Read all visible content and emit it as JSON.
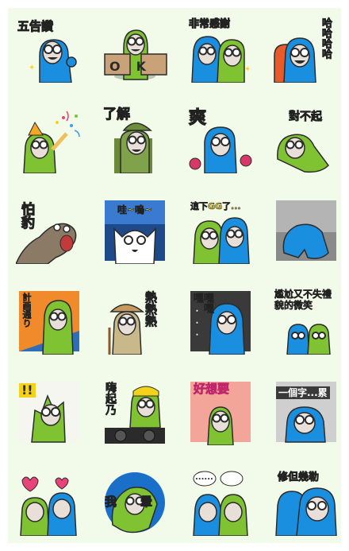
{
  "colors": {
    "sheet_bg": "#f2fbe9",
    "blue_char": "#1a8fe0",
    "green_char": "#7fc232",
    "skin": "#e8e0d8",
    "outline": "#2b2b2b"
  },
  "stickers": [
    {
      "id": 1,
      "caption": "五告讚",
      "character": "blue"
    },
    {
      "id": 2,
      "caption": "OK",
      "character": "green"
    },
    {
      "id": 3,
      "caption": "非常感謝",
      "character": "blue-green"
    },
    {
      "id": 4,
      "caption": "哈哈哈哈",
      "character": "blue"
    },
    {
      "id": 5,
      "caption": "",
      "character": "green"
    },
    {
      "id": 6,
      "caption": "了解",
      "character": "green"
    },
    {
      "id": 7,
      "caption": "爽",
      "character": "blue"
    },
    {
      "id": 8,
      "caption": "對不起",
      "character": "green"
    },
    {
      "id": 9,
      "caption": "怕豹",
      "character": "seal"
    },
    {
      "id": 10,
      "caption": "哇~嗚~",
      "character": "cat"
    },
    {
      "id": 11,
      "caption": "這下GG了...",
      "character": "green-blue"
    },
    {
      "id": 12,
      "caption": "",
      "character": "blue"
    },
    {
      "id": 13,
      "caption": "計画通り",
      "character": "green"
    },
    {
      "id": 14,
      "caption": "熱熱熱",
      "character": "explorer"
    },
    {
      "id": 15,
      "caption": "嘿嘿嘿...",
      "character": "blue"
    },
    {
      "id": 16,
      "caption": "尷尬又不失禮貌的微笑",
      "character": "blue-green"
    },
    {
      "id": 17,
      "caption": "!!",
      "character": "green"
    },
    {
      "id": 18,
      "caption": "嗨起乃",
      "character": "green-dj"
    },
    {
      "id": 19,
      "caption": "好想要",
      "character": "green"
    },
    {
      "id": 20,
      "caption": "一個字...累",
      "character": "blue"
    },
    {
      "id": 21,
      "caption": "",
      "character": "blue-green"
    },
    {
      "id": 22,
      "caption": "我暈",
      "character": "green"
    },
    {
      "id": 23,
      "caption": "......",
      "character": "blue-green"
    },
    {
      "id": 24,
      "caption": "修但幾勒",
      "character": "blue"
    }
  ]
}
